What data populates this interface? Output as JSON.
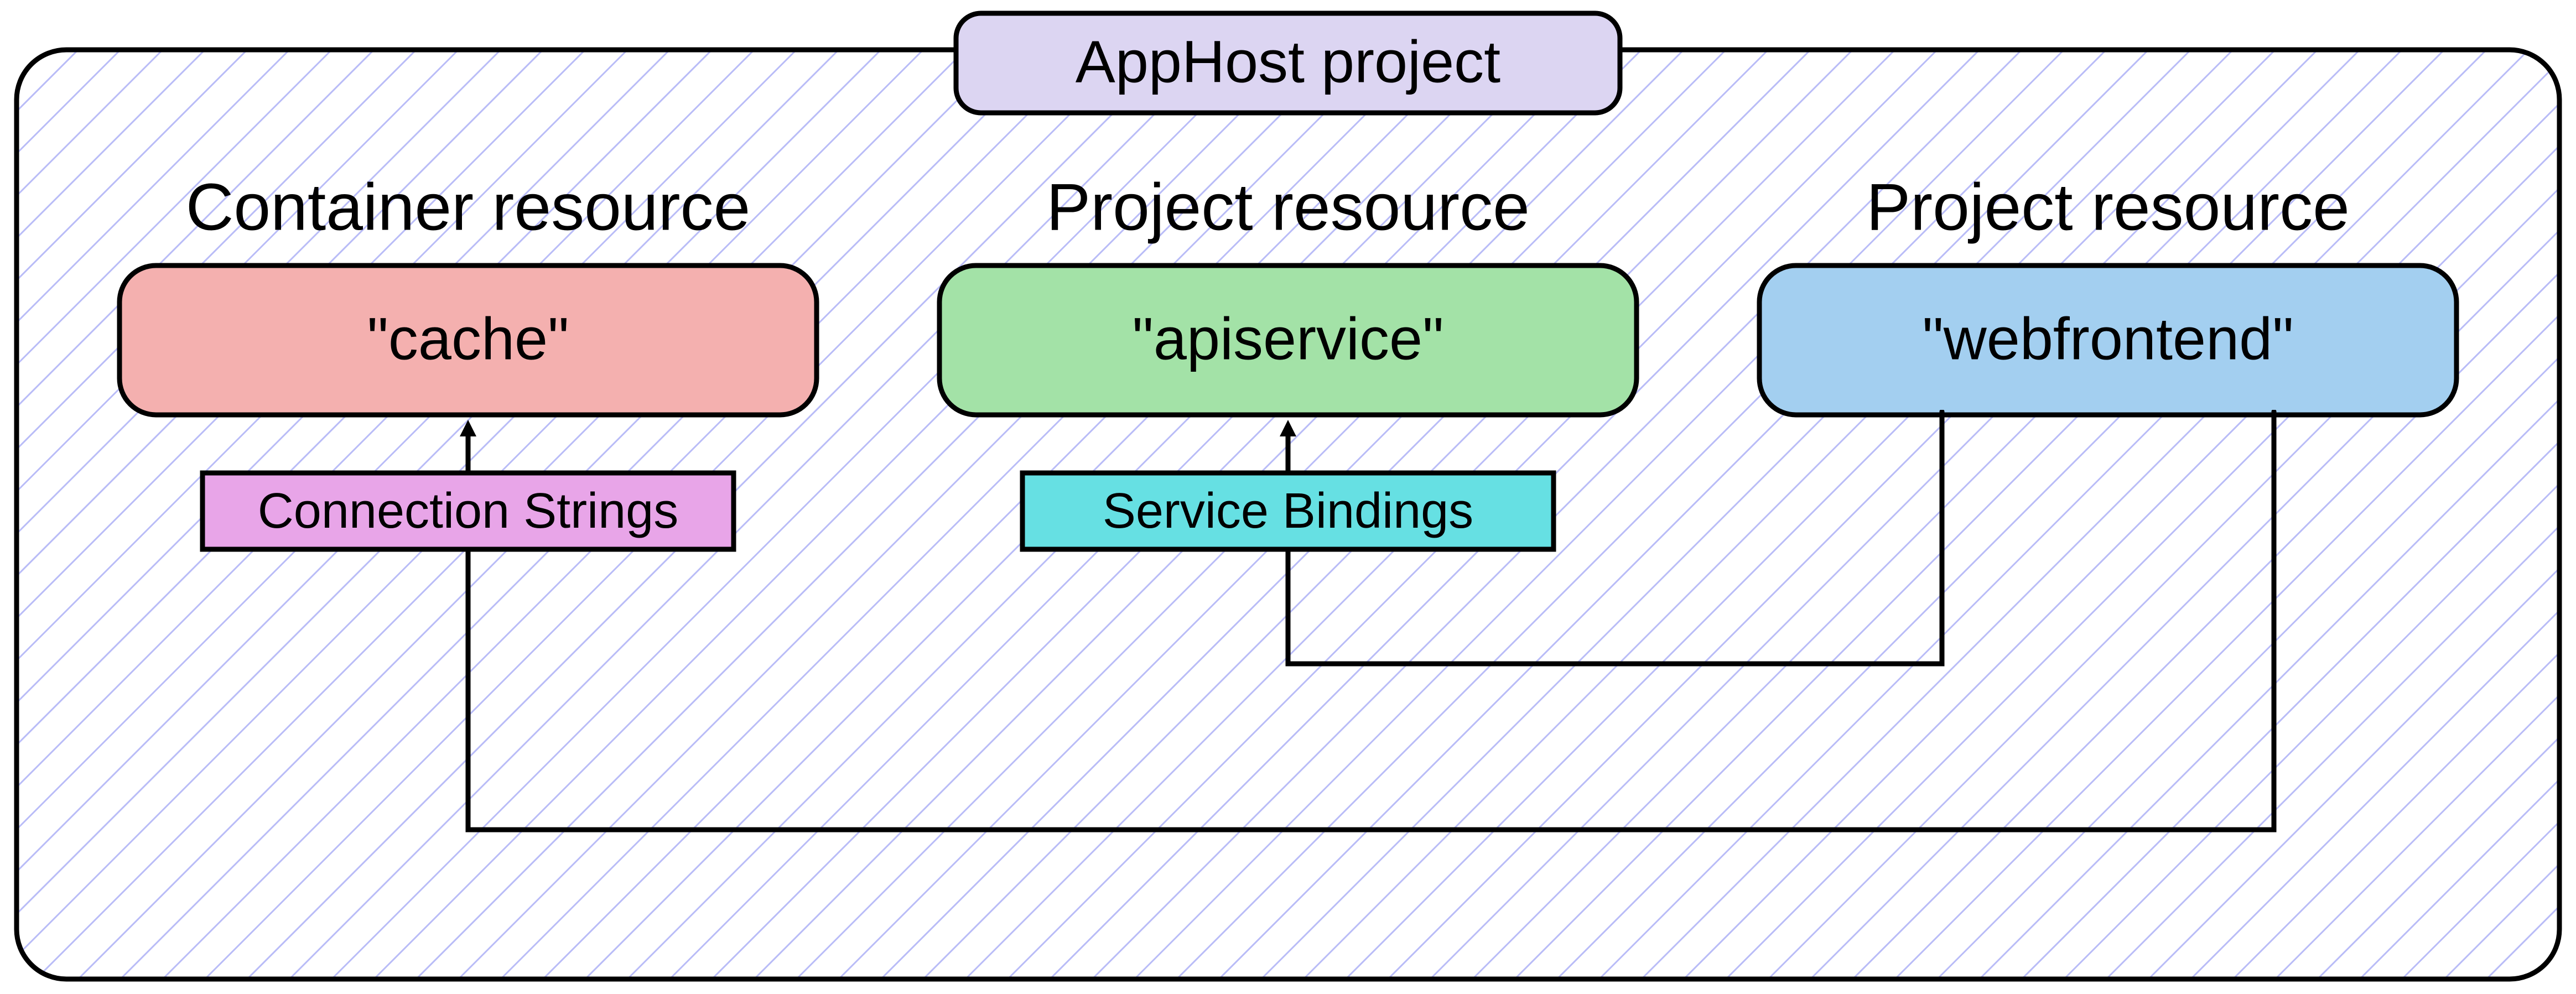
{
  "container": {
    "title": "AppHost project"
  },
  "resources": {
    "cache": {
      "heading": "Container resource",
      "label": "\"cache\""
    },
    "apiservice": {
      "heading": "Project resource",
      "label": "\"apiservice\""
    },
    "webfrontend": {
      "heading": "Project resource",
      "label": "\"webfrontend\""
    }
  },
  "links": {
    "connection_strings": "Connection Strings",
    "service_bindings": "Service Bindings"
  },
  "colors": {
    "container_fill_pattern_stroke": "#9a9cff",
    "title_fill": "#dcd5f2",
    "cache_fill": "#f4b0af",
    "apiservice_fill": "#a3e2a7",
    "webfrontend_fill": "#a3cff0",
    "conn_strings_fill": "#e8a5e8",
    "service_bindings_fill": "#66e0e3",
    "stroke": "#000000"
  }
}
